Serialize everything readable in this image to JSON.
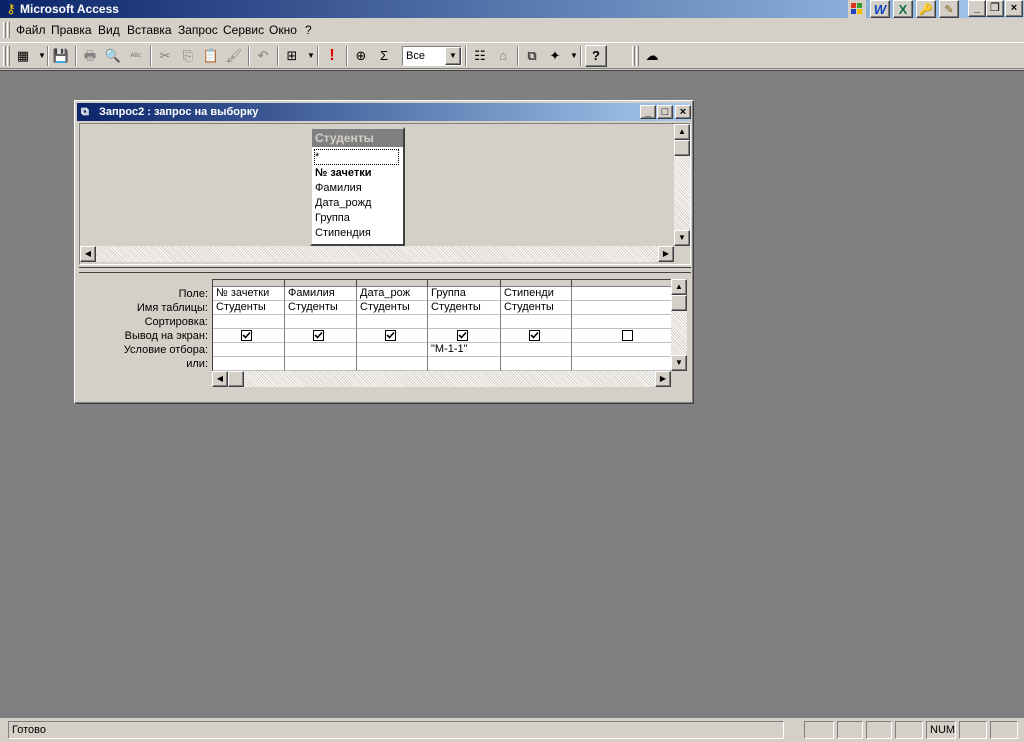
{
  "app": {
    "title": "Microsoft Access",
    "title_controls": {
      "minimize": "_",
      "restore": "❐",
      "close": "×"
    },
    "office_icons": [
      "W",
      "X",
      "🔑",
      "✎"
    ]
  },
  "menu": {
    "items": [
      {
        "label": "Файл"
      },
      {
        "label": "Правка"
      },
      {
        "label": "Вид"
      },
      {
        "label": "Вставка"
      },
      {
        "label": "Запрос"
      },
      {
        "label": "Сервис"
      },
      {
        "label": "Окно"
      },
      {
        "label": "?"
      }
    ]
  },
  "toolbar": {
    "combo_value": "Все",
    "glyphs": {
      "view": "▦",
      "save": "💾",
      "print": "🖶",
      "preview": "🔍",
      "spelling": "ᴬᴮᶜ",
      "cut": "✂",
      "copy": "⎘",
      "paste": "📋",
      "format_painter": "🖌",
      "undo": "↶",
      "query_type": "⊞",
      "run": "!",
      "show_table": "⊕",
      "totals": "Σ",
      "properties": "☷",
      "build": "⌂",
      "database": "⧉",
      "new_object": "✦",
      "help": "?",
      "office_assistant": "☁"
    }
  },
  "query_window": {
    "title": "Запрос2 : запрос на выборку",
    "controls": {
      "minimize": "_",
      "maximize": "□",
      "close": "×"
    },
    "table": {
      "title": "Студенты",
      "fields": [
        "*",
        "№ зачетки",
        "Фамилия",
        "Дата_рожд",
        "Группа",
        "Стипендия"
      ]
    },
    "row_labels": [
      "Поле:",
      "Имя таблицы:",
      "Сортировка:",
      "Вывод на экран:",
      "Условие отбора:",
      "или:"
    ],
    "columns": [
      {
        "field": "№ зачетки",
        "table": "Студенты",
        "sort": "",
        "show": true,
        "criteria": "",
        "or": ""
      },
      {
        "field": "Фамилия",
        "table": "Студенты",
        "sort": "",
        "show": true,
        "criteria": "",
        "or": ""
      },
      {
        "field": "Дата_рож",
        "table": "Студенты",
        "sort": "",
        "show": true,
        "criteria": "",
        "or": ""
      },
      {
        "field": "Группа",
        "table": "Студенты",
        "sort": "",
        "show": true,
        "criteria": "\"М-1-1\"",
        "or": ""
      },
      {
        "field": "Стипенди",
        "table": "Студенты",
        "sort": "",
        "show": true,
        "criteria": "",
        "or": ""
      },
      {
        "field": "",
        "table": "",
        "sort": "",
        "show": false,
        "criteria": "",
        "or": ""
      }
    ]
  },
  "scroll": {
    "up": "▲",
    "down": "▼",
    "left": "◀",
    "right": "▶"
  },
  "statusbar": {
    "status": "Готово",
    "num": "NUM"
  }
}
